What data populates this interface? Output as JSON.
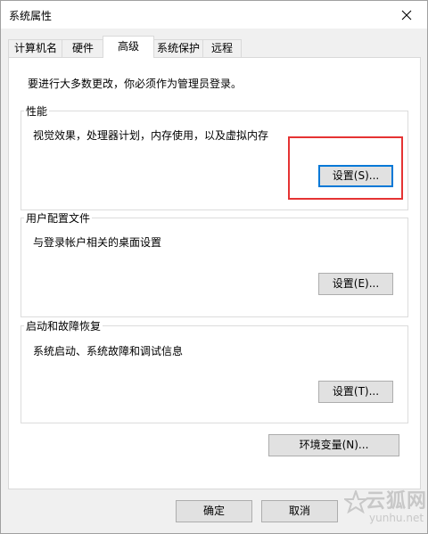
{
  "window": {
    "title": "系统属性"
  },
  "tabs": [
    {
      "label": "计算机名",
      "active": false
    },
    {
      "label": "硬件",
      "active": false
    },
    {
      "label": "高级",
      "active": true
    },
    {
      "label": "系统保护",
      "active": false
    },
    {
      "label": "远程",
      "active": false
    }
  ],
  "intro": "要进行大多数更改，你必须作为管理员登录。",
  "performance": {
    "title": "性能",
    "description": "视觉效果，处理器计划，内存使用，以及虚拟内存",
    "button": "设置(S)..."
  },
  "user_profiles": {
    "title": "用户配置文件",
    "description": "与登录帐户相关的桌面设置",
    "button": "设置(E)..."
  },
  "startup_recovery": {
    "title": "启动和故障恢复",
    "description": "系统启动、系统故障和调试信息",
    "button": "设置(T)..."
  },
  "env_button": "环境变量(N)...",
  "footer": {
    "ok": "确定",
    "cancel": "取消"
  },
  "watermark": {
    "brand": "云狐网",
    "url": "yunhu.net"
  },
  "colors": {
    "highlight": "#e53333",
    "accent": "#0078d7"
  }
}
